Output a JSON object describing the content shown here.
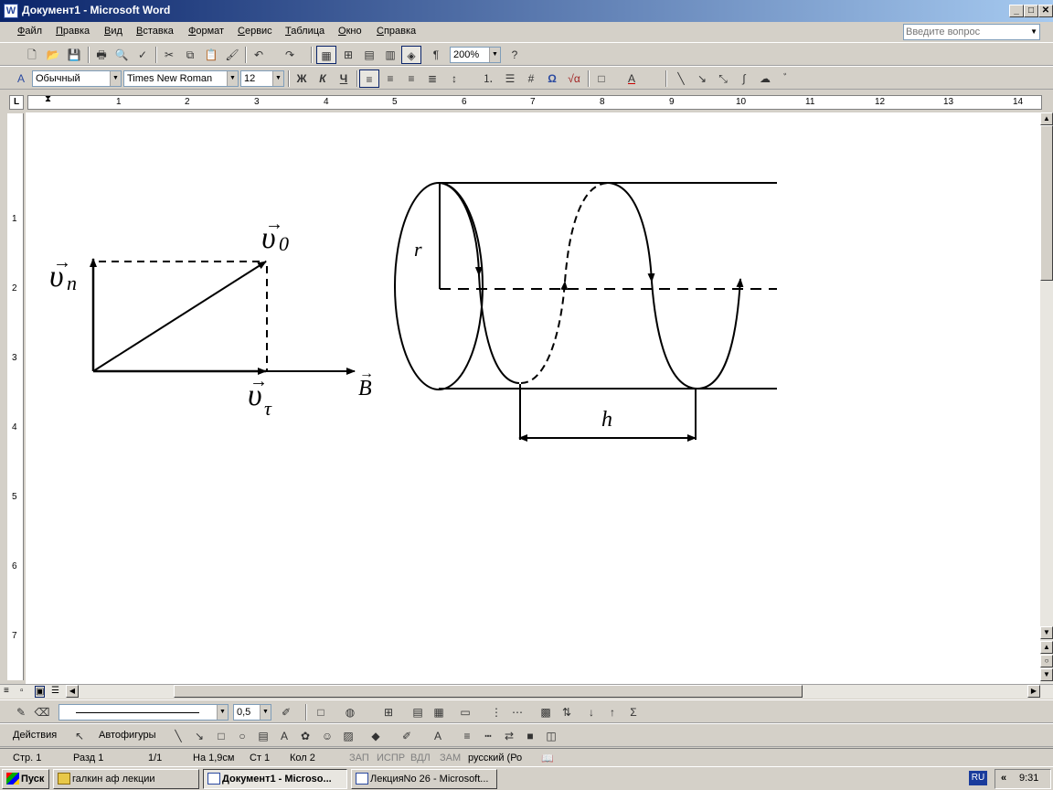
{
  "window": {
    "title": "Документ1 - Microsoft Word",
    "app_icon": "W",
    "minimize": "_",
    "maximize": "□",
    "close": "✕"
  },
  "menu": {
    "items": [
      "Файл",
      "Правка",
      "Вид",
      "Вставка",
      "Формат",
      "Сервис",
      "Таблица",
      "Окно",
      "Справка"
    ]
  },
  "help": {
    "placeholder": "Введите вопрос"
  },
  "standard_toolbar": {
    "zoom": "200%"
  },
  "formatting_toolbar": {
    "style": "Обычный",
    "font": "Times New Roman",
    "size": "12",
    "bold": "Ж",
    "italic": "К",
    "underline": "Ч"
  },
  "ruler": {
    "tab_marker": "L",
    "numbers": [
      "1",
      "2",
      "3",
      "4",
      "5",
      "6",
      "7",
      "8",
      "9",
      "10",
      "11",
      "12",
      "13",
      "14"
    ],
    "vnumbers": [
      "1",
      "2",
      "3",
      "4",
      "5",
      "6",
      "7"
    ]
  },
  "figure": {
    "v0_base": "υ",
    "v0_sub": "0",
    "vn_base": "υ",
    "vn_sub": "n",
    "vt_base": "υ",
    "vt_sub": "τ",
    "B": "B",
    "r": "r",
    "h": "h"
  },
  "line_toolbar": {
    "width": "0,5"
  },
  "drawing_toolbar": {
    "actions": "Действия",
    "autoshapes": "Автофигуры"
  },
  "status": {
    "page": "Стр. 1",
    "section": "Разд 1",
    "pages": "1/1",
    "at": "На 1,9см",
    "line": "Ст 1",
    "col": "Кол 2",
    "rec": "ЗАП",
    "trk": "ИСПР",
    "ext": "ВДЛ",
    "ovr": "ЗАМ",
    "lang": "русский (Ро"
  },
  "taskbar": {
    "start": "Пуск",
    "tasks": [
      "галкин аф лекции",
      "Документ1 - Microso...",
      "ЛекцияNo 26 - Microsoft..."
    ],
    "lang": "RU",
    "chevron": "«",
    "clock": "9:31"
  }
}
